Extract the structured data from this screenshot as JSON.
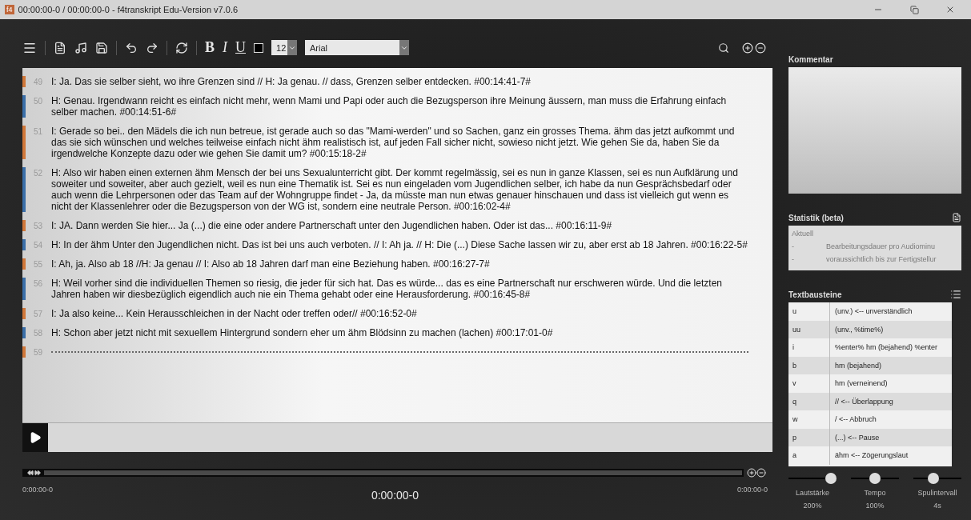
{
  "window": {
    "title": "00:00:00-0 / 00:00:00-0 -  f4transkript Edu-Version v7.0.6",
    "app_badge": "f4"
  },
  "toolbar": {
    "format_buttons": [
      "B",
      "I",
      "U"
    ],
    "font_size": "12",
    "font": "Arial"
  },
  "segments": [
    {
      "number": "49",
      "color": "#d0773a",
      "text": "I: Ja. Das sie selber sieht, wo ihre Grenzen sind // H: Ja genau. // dass, Grenzen selber entdecken.  #00:14:41-7#"
    },
    {
      "number": "50",
      "color": "#3a6ea8",
      "text": "H: Genau. Irgendwann reicht es einfach nicht mehr, wenn Mami und Papi oder auch die Bezugsperson ihre Meinung äussern, man muss die Erfahrung einfach selber machen. #00:14:51-6#"
    },
    {
      "number": "51",
      "color": "#d0773a",
      "text": "I: Gerade so bei.. den Mädels die ich nun betreue, ist gerade auch so das \"Mami-werden\" und so Sachen, ganz ein grosses Thema. ähm das jetzt aufkommt und das sie sich wünschen und welches teilweise einfach nicht ähm realistisch ist, auf jeden Fall sicher nicht, sowieso nicht jetzt. Wie gehen Sie da, haben Sie da irgendwelche Konzepte dazu oder wie gehen Sie damit um? #00:15:18-2#"
    },
    {
      "number": "52",
      "color": "#3a6ea8",
      "text": "H: Also wir haben einen externen ähm Mensch der bei uns Sexualunterricht gibt. Der kommt regelmässig, sei es nun in ganze Klassen, sei es nun Aufklärung und soweiter und soweiter, aber auch gezielt, weil es nun eine Thematik ist. Sei es nun eingeladen vom Jugendlichen selber, ich habe da nun Gesprächsbedarf oder auch wenn die Lehrpersonen oder das Team auf der Wohngruppe findet - Ja, da müsste man nun etwas genauer hinschauen und dass ist vielleich gut wenn es nicht der Klassenlehrer oder die Bezugsperson von der WG ist, sondern eine neutrale Person.  #00:16:02-4#"
    },
    {
      "number": "53",
      "color": "#d0773a",
      "text": "I: JA. Dann werden Sie hier... Ja (...) die eine oder andere Partnerschaft unter den Jugendlichen haben. Oder ist das... #00:16:11-9#"
    },
    {
      "number": "54",
      "color": "#3a6ea8",
      "text": "H: In der ähm Unter den Jugendlichen nicht. Das ist bei uns auch verboten. // I: Ah ja. // H: Die (...) Diese Sache lassen wir zu, aber erst ab 18 Jahren. #00:16:22-5#"
    },
    {
      "number": "55",
      "color": "#d0773a",
      "text": "I: Ah, ja. Also ab 18 //H: Ja genau // I: Also ab 18 Jahren darf man eine Beziehung haben. #00:16:27-7#"
    },
    {
      "number": "56",
      "color": "#3a6ea8",
      "text": "H: Weil vorher sind die individuellen Themen so riesig, die jeder für sich hat. Das es würde... das es eine Partnerschaft nur erschweren würde. Und die letzten Jahren haben wir diesbezüglich eigendlich auch nie ein Thema gehabt oder eine Herausforderung. #00:16:45-8#"
    },
    {
      "number": "57",
      "color": "#d0773a",
      "text": "I: Ja also keine... Kein Herausschleichen in der Nacht oder treffen oder//  #00:16:52-0#"
    },
    {
      "number": "58",
      "color": "#3a6ea8",
      "text": "H: Schon aber jetzt nicht mit sexuellem Hintergrund sondern eher um ähm Blödsinn zu machen (lachen) #00:17:01-0#"
    },
    {
      "number": "59",
      "color": "#d0773a"
    }
  ],
  "player": {
    "time_start": "0:00:00-0",
    "time_current": "0:00:00-0",
    "time_end": "0:00:00-0"
  },
  "comment": {
    "title": "Kommentar"
  },
  "statistics": {
    "title": "Statistik (beta)",
    "rows": [
      {
        "label": "Aktuell"
      },
      {
        "label": "-",
        "value": "Bearbeitungsdauer pro Audiominu"
      },
      {
        "label": "-",
        "value": "voraussichtlich bis zur Fertigstellur"
      }
    ]
  },
  "snippets": {
    "title": "Textbausteine",
    "rows": [
      {
        "key": "u",
        "text": "(unv.) <-- unverständlich"
      },
      {
        "key": "uu",
        "text": "(unv., %time%)"
      },
      {
        "key": "i",
        "text": "%enter% hm (bejahend) %enter"
      },
      {
        "key": "b",
        "text": "hm (bejahend)"
      },
      {
        "key": "v",
        "text": "hm (verneinend)"
      },
      {
        "key": "q",
        "text": "// <-- Überlappung"
      },
      {
        "key": "w",
        "text": "/ <-- Abbruch"
      },
      {
        "key": "p",
        "text": "(...) <-- Pause"
      },
      {
        "key": "a",
        "text": "ähm <-- Zögerungslaut"
      }
    ]
  },
  "sliders": [
    {
      "label": "Lautstärke",
      "value": "200%",
      "level": 1.0
    },
    {
      "label": "Tempo",
      "value": "100%",
      "level": 0.5
    },
    {
      "label": "Spulintervall",
      "value": "4s",
      "level": 0.4
    }
  ]
}
